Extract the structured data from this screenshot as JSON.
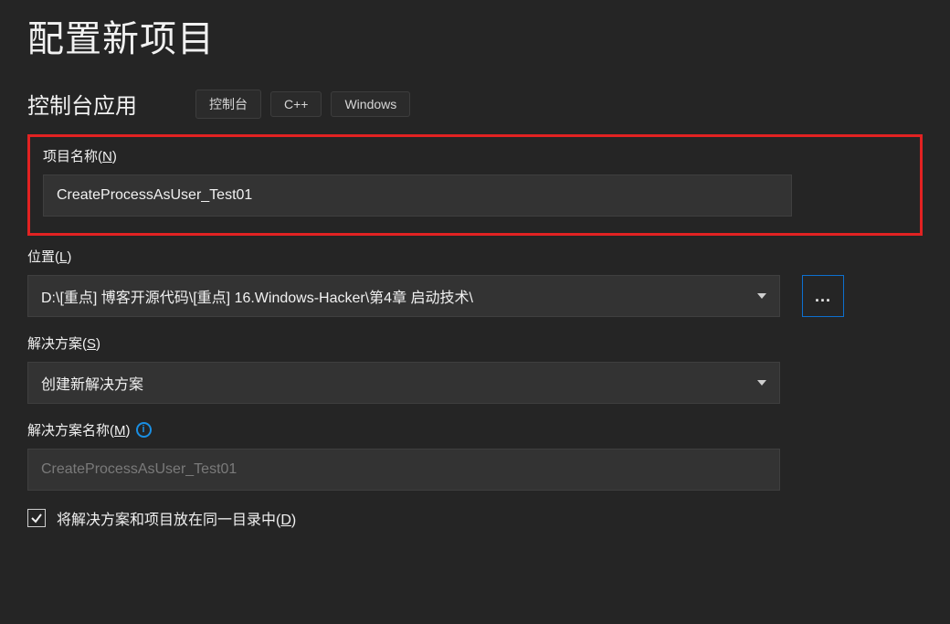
{
  "title": "配置新项目",
  "subtitle": "控制台应用",
  "tags": [
    "控制台",
    "C++",
    "Windows"
  ],
  "projectName": {
    "labelPrefix": "项目名称(",
    "hotkey": "N",
    "labelSuffix": ")",
    "value": "CreateProcessAsUser_Test01"
  },
  "location": {
    "labelPrefix": "位置(",
    "hotkey": "L",
    "labelSuffix": ")",
    "value": "D:\\[重点] 博客开源代码\\[重点] 16.Windows-Hacker\\第4章 启动技术\\",
    "browseLabel": "..."
  },
  "solution": {
    "labelPrefix": "解决方案(",
    "hotkey": "S",
    "labelSuffix": ")",
    "value": "创建新解决方案"
  },
  "solutionName": {
    "labelPrefix": "解决方案名称(",
    "hotkey": "M",
    "labelSuffix": ")",
    "value": "CreateProcessAsUser_Test01",
    "infoGlyph": "i"
  },
  "sameDirCheckbox": {
    "labelPrefix": "将解决方案和项目放在同一目录中(",
    "hotkey": "D",
    "labelSuffix": ")",
    "checked": true
  }
}
